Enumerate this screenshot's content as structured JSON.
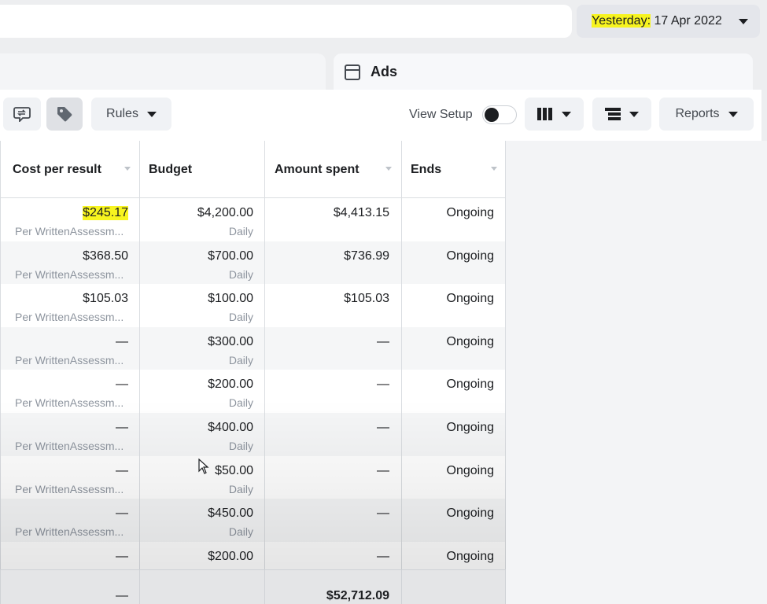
{
  "date_picker": {
    "highlight": "Yesterday:",
    "date": " 17 Apr 2022"
  },
  "tabs": {
    "ads_label": "Ads"
  },
  "toolbar": {
    "rules_label": "Rules",
    "view_setup_label": "View Setup",
    "reports_label": "Reports"
  },
  "table": {
    "headers": [
      "Cost per result",
      "Budget",
      "Amount spent",
      "Ends"
    ],
    "rows": [
      {
        "cost": "$245.17",
        "cost_sub": "Per WrittenAssessm...",
        "budget": "$4,200.00",
        "budget_sub": "Daily",
        "spent": "$4,413.15",
        "ends": "Ongoing"
      },
      {
        "cost": "$368.50",
        "cost_sub": "Per WrittenAssessm...",
        "budget": "$700.00",
        "budget_sub": "Daily",
        "spent": "$736.99",
        "ends": "Ongoing"
      },
      {
        "cost": "$105.03",
        "cost_sub": "Per WrittenAssessm...",
        "budget": "$100.00",
        "budget_sub": "Daily",
        "spent": "$105.03",
        "ends": "Ongoing"
      },
      {
        "cost": "—",
        "cost_sub": "Per WrittenAssessm...",
        "budget": "$300.00",
        "budget_sub": "Daily",
        "spent": "—",
        "ends": "Ongoing"
      },
      {
        "cost": "—",
        "cost_sub": "Per WrittenAssessm...",
        "budget": "$200.00",
        "budget_sub": "Daily",
        "spent": "—",
        "ends": "Ongoing"
      },
      {
        "cost": "—",
        "cost_sub": "Per WrittenAssessm...",
        "budget": "$400.00",
        "budget_sub": "Daily",
        "spent": "—",
        "ends": "Ongoing"
      },
      {
        "cost": "—",
        "cost_sub": "Per WrittenAssessm...",
        "budget": "$50.00",
        "budget_sub": "Daily",
        "spent": "—",
        "ends": "Ongoing"
      },
      {
        "cost": "—",
        "cost_sub": "Per WrittenAssessm...",
        "budget": "$450.00",
        "budget_sub": "Daily",
        "spent": "—",
        "ends": "Ongoing"
      },
      {
        "cost": "—",
        "cost_sub": "",
        "budget": "$200.00",
        "budget_sub": "",
        "spent": "—",
        "ends": "Ongoing"
      }
    ],
    "totals": {
      "cost": "—",
      "spent": "$52,712.09"
    }
  }
}
